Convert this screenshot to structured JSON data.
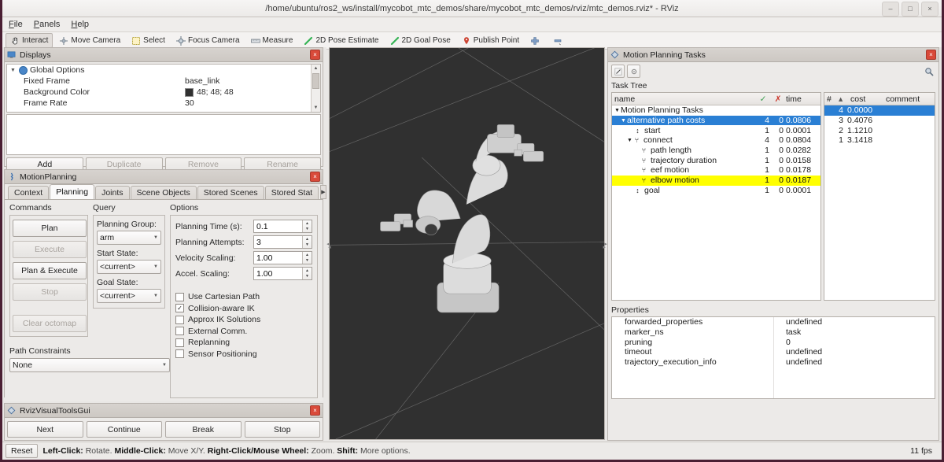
{
  "window": {
    "title": "/home/ubuntu/ros2_ws/install/mycobot_mtc_demos/share/mycobot_mtc_demos/rviz/mtc_demos.rviz* - RViz",
    "minimize": "–",
    "maximize": "□",
    "close": "×"
  },
  "menu": {
    "items": [
      "File",
      "Panels",
      "Help"
    ]
  },
  "toolbar": {
    "items": [
      {
        "label": "Interact",
        "icon": "hand-cursor-icon",
        "active": true
      },
      {
        "label": "Move Camera",
        "icon": "move-camera-icon",
        "active": false
      },
      {
        "label": "Select",
        "icon": "select-rect-icon",
        "active": false
      },
      {
        "label": "Focus Camera",
        "icon": "focus-camera-icon",
        "active": false
      },
      {
        "label": "Measure",
        "icon": "measure-icon",
        "active": false
      },
      {
        "label": "2D Pose Estimate",
        "icon": "pose-arrow-icon",
        "active": false
      },
      {
        "label": "2D Goal Pose",
        "icon": "goal-arrow-icon",
        "active": false
      },
      {
        "label": "Publish Point",
        "icon": "publish-point-icon",
        "active": false
      },
      {
        "label": "",
        "icon": "add-tool-icon",
        "active": false
      },
      {
        "label": "",
        "icon": "remove-tool-icon",
        "active": false
      }
    ]
  },
  "displays": {
    "title": "Displays",
    "root": "Global Options",
    "rows": [
      {
        "name": "Fixed Frame",
        "value": "base_link",
        "swatch": false
      },
      {
        "name": "Background Color",
        "value": "48; 48; 48",
        "swatch": true,
        "swatch_color": "#303030"
      },
      {
        "name": "Frame Rate",
        "value": "30",
        "swatch": false
      }
    ],
    "buttons": [
      {
        "label": "Add",
        "enabled": true
      },
      {
        "label": "Duplicate",
        "enabled": false
      },
      {
        "label": "Remove",
        "enabled": false
      },
      {
        "label": "Rename",
        "enabled": false
      }
    ]
  },
  "motion_planning": {
    "title": "MotionPlanning",
    "tabs": [
      {
        "label": "Context",
        "selected": false
      },
      {
        "label": "Planning",
        "selected": true
      },
      {
        "label": "Joints",
        "selected": false
      },
      {
        "label": "Scene Objects",
        "selected": false
      },
      {
        "label": "Stored Scenes",
        "selected": false
      },
      {
        "label": "Stored Stat",
        "selected": false
      }
    ],
    "commands": {
      "label": "Commands",
      "buttons": [
        {
          "label": "Plan",
          "mnemonic": "l",
          "enabled": true
        },
        {
          "label": "Execute",
          "mnemonic": "",
          "enabled": false
        },
        {
          "label": "Plan & Execute",
          "mnemonic": "E",
          "enabled": true
        },
        {
          "label": "Stop",
          "mnemonic": "",
          "enabled": false
        },
        {
          "label": "Clear octomap",
          "mnemonic": "",
          "enabled": false
        }
      ]
    },
    "query": {
      "label": "Query",
      "fields": [
        {
          "label": "Planning Group:",
          "value": "arm"
        },
        {
          "label": "Start State:",
          "value": "<current>"
        },
        {
          "label": "Goal State:",
          "value": "<current>"
        }
      ]
    },
    "options": {
      "label": "Options",
      "spinners": [
        {
          "label": "Planning Time (s):",
          "value": "0.1"
        },
        {
          "label": "Planning Attempts:",
          "value": "3"
        },
        {
          "label": "Velocity Scaling:",
          "value": "1.00"
        },
        {
          "label": "Accel. Scaling:",
          "value": "1.00"
        }
      ],
      "checkboxes": [
        {
          "label": "Use Cartesian Path",
          "checked": false
        },
        {
          "label": "Collision-aware IK",
          "checked": true
        },
        {
          "label": "Approx IK Solutions",
          "checked": false
        },
        {
          "label": "External Comm.",
          "checked": false
        },
        {
          "label": "Replanning",
          "checked": false
        },
        {
          "label": "Sensor Positioning",
          "checked": false
        }
      ]
    },
    "path_constraints": {
      "label": "Path Constraints",
      "value": "None"
    }
  },
  "tasks": {
    "title": "Motion Planning Tasks",
    "toolbar_icons": [
      "exec-task-icon",
      "settings-gear-icon",
      "magnifier-icon"
    ],
    "task_tree_label": "Task Tree",
    "tree_headers": {
      "name": "name",
      "success": "✓",
      "failure": "✗",
      "time": "time"
    },
    "tree_rows": [
      {
        "name": "Motion Planning Tasks",
        "indent": 0,
        "expander": "▾",
        "icon": "",
        "success": "",
        "failure": "",
        "time": "",
        "state": "normal"
      },
      {
        "name": "alternative path costs",
        "indent": 1,
        "expander": "▾",
        "icon": "",
        "success": "4",
        "failure": "0",
        "time": "0.0806",
        "state": "selected"
      },
      {
        "name": "start",
        "indent": 2,
        "expander": "",
        "icon": "↕",
        "success": "1",
        "failure": "0",
        "time": "0.0001",
        "state": "normal"
      },
      {
        "name": "connect",
        "indent": 2,
        "expander": "▾",
        "icon": "⑂",
        "success": "4",
        "failure": "0",
        "time": "0.0804",
        "state": "normal"
      },
      {
        "name": "path length",
        "indent": 3,
        "expander": "",
        "icon": "⑂",
        "success": "1",
        "failure": "0",
        "time": "0.0282",
        "state": "normal"
      },
      {
        "name": "trajectory duration",
        "indent": 3,
        "expander": "",
        "icon": "⑂",
        "success": "1",
        "failure": "0",
        "time": "0.0158",
        "state": "normal"
      },
      {
        "name": "eef motion",
        "indent": 3,
        "expander": "",
        "icon": "⑂",
        "success": "1",
        "failure": "0",
        "time": "0.0178",
        "state": "normal"
      },
      {
        "name": "elbow motion",
        "indent": 3,
        "expander": "",
        "icon": "⑂",
        "success": "1",
        "failure": "0",
        "time": "0.0187",
        "state": "highlighted"
      },
      {
        "name": "goal",
        "indent": 2,
        "expander": "",
        "icon": "↕",
        "success": "1",
        "failure": "0",
        "time": "0.0001",
        "state": "normal"
      }
    ],
    "cost_headers": {
      "index": "#",
      "sort": "▴",
      "cost": "cost",
      "comment": "comment"
    },
    "cost_rows": [
      {
        "index": "4",
        "cost": "0.0000",
        "comment": "",
        "selected": true
      },
      {
        "index": "3",
        "cost": "0.4076",
        "comment": "",
        "selected": false
      },
      {
        "index": "2",
        "cost": "1.1210",
        "comment": "",
        "selected": false
      },
      {
        "index": "1",
        "cost": "3.1418",
        "comment": "",
        "selected": false
      }
    ],
    "properties_label": "Properties",
    "properties": [
      {
        "key": "forwarded_properties",
        "value": "undefined"
      },
      {
        "key": "marker_ns",
        "value": "task"
      },
      {
        "key": "pruning",
        "value": "0"
      },
      {
        "key": "timeout",
        "value": "undefined"
      },
      {
        "key": "trajectory_execution_info",
        "value": "undefined"
      }
    ]
  },
  "visual_tools": {
    "title": "RvizVisualToolsGui",
    "buttons": [
      "Next",
      "Continue",
      "Break",
      "Stop"
    ]
  },
  "status": {
    "reset": "Reset",
    "hints": [
      {
        "bold": "Left-Click:",
        "text": " Rotate. "
      },
      {
        "bold": "Middle-Click:",
        "text": " Move X/Y. "
      },
      {
        "bold": "Right-Click/Mouse Wheel:",
        "text": " Zoom. "
      },
      {
        "bold": "Shift:",
        "text": " More options."
      }
    ],
    "fps": "11 fps"
  },
  "colors": {
    "selection_blue": "#2a7fd4",
    "highlight_yellow": "#ffff00",
    "viewport_bg": "#303030",
    "close_red": "#d94a3a"
  }
}
